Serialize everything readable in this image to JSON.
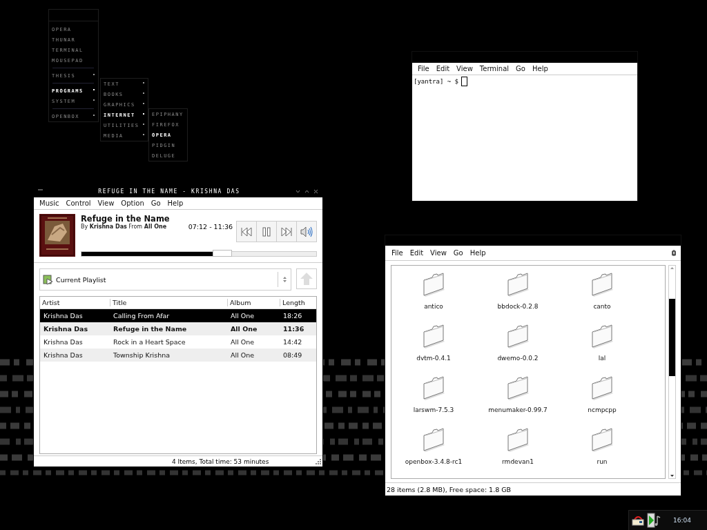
{
  "menus": [
    {
      "items": [
        {
          "kind": "item",
          "label": "OPERA",
          "submenu": false,
          "selected": false
        },
        {
          "kind": "item",
          "label": "THUNAR",
          "submenu": false,
          "selected": false
        },
        {
          "kind": "item",
          "label": "TERMINAL",
          "submenu": false,
          "selected": false
        },
        {
          "kind": "item",
          "label": "MOUSEPAD",
          "submenu": false,
          "selected": false
        },
        {
          "kind": "separator"
        },
        {
          "kind": "item",
          "label": "THESIS",
          "submenu": true,
          "selected": false
        },
        {
          "kind": "separator"
        },
        {
          "kind": "item",
          "label": "PROGRAMS",
          "submenu": true,
          "selected": true
        },
        {
          "kind": "item",
          "label": "SYSTEM",
          "submenu": true,
          "selected": false
        },
        {
          "kind": "separator"
        },
        {
          "kind": "item",
          "label": "OPENBOX",
          "submenu": true,
          "selected": false
        }
      ]
    },
    {
      "items": [
        {
          "kind": "item",
          "label": "TEXT",
          "submenu": true,
          "selected": false
        },
        {
          "kind": "item",
          "label": "BOOKS",
          "submenu": true,
          "selected": false
        },
        {
          "kind": "item",
          "label": "GRAPHICS",
          "submenu": true,
          "selected": false
        },
        {
          "kind": "item",
          "label": "INTERNET",
          "submenu": true,
          "selected": true
        },
        {
          "kind": "item",
          "label": "UTILITIES",
          "submenu": true,
          "selected": false
        },
        {
          "kind": "item",
          "label": "MEDIA",
          "submenu": true,
          "selected": false
        }
      ]
    },
    {
      "items": [
        {
          "kind": "item",
          "label": "EPIPHANY",
          "submenu": false,
          "selected": false
        },
        {
          "kind": "item",
          "label": "FIREFOX",
          "submenu": false,
          "selected": false
        },
        {
          "kind": "item",
          "label": "OPERA",
          "submenu": false,
          "selected": true
        },
        {
          "kind": "item",
          "label": "PIDGIN",
          "submenu": false,
          "selected": false
        },
        {
          "kind": "item",
          "label": "DELUGE",
          "submenu": false,
          "selected": false
        }
      ]
    }
  ],
  "player": {
    "window": {
      "title": "REFUGE IN THE NAME - KRISHNA DAS"
    },
    "menu": [
      "Music",
      "Control",
      "View",
      "Option",
      "Go",
      "Help"
    ],
    "track": {
      "title": "Refuge in the Name",
      "byline": "By **Krishna Das** From **All One**",
      "time": "07:12 - 11:36",
      "level": 0.56
    },
    "playlist": {
      "value": "Current Playlist"
    },
    "table": {
      "columns": [
        "Artist",
        "Title",
        "Album",
        "Length"
      ],
      "rows": [
        {
          "cells": [
            "Krishna Das",
            "Calling From Afar",
            "All One",
            "18:26"
          ],
          "selected": true,
          "playing": false
        },
        {
          "cells": [
            "Krishna Das",
            "Refuge in the Name",
            "All One",
            "11:36"
          ],
          "selected": false,
          "playing": true
        },
        {
          "cells": [
            "Krishna Das",
            "Rock in a Heart Space",
            "All One",
            "14:42"
          ],
          "selected": false,
          "playing": false
        },
        {
          "cells": [
            "Krishna Das",
            "Township Krishna",
            "All One",
            "08:49"
          ],
          "selected": false,
          "playing": false
        }
      ]
    },
    "status_bar": "4 Items, Total time: 53 minutes"
  },
  "terminal": {
    "menu": [
      "File",
      "Edit",
      "View",
      "Terminal",
      "Go",
      "Help"
    ],
    "prompt": "[yantra] ~ $"
  },
  "files": {
    "menu": [
      "File",
      "Edit",
      "View",
      "Go",
      "Help"
    ],
    "items": [
      "antico",
      "bbdock-0.2.8",
      "canto",
      "dvtm-0.4.1",
      "dwemo-0.0.2",
      "lal",
      "larswm-7.5.3",
      "menumaker-0.99.7",
      "ncmpcpp",
      "openbox-3.4.8-rc1",
      "rmdevan1",
      "run"
    ],
    "status_bar": "28 items (2.8 MB), Free space: 1.8 GB"
  },
  "tray": {
    "clock": "16:04"
  }
}
